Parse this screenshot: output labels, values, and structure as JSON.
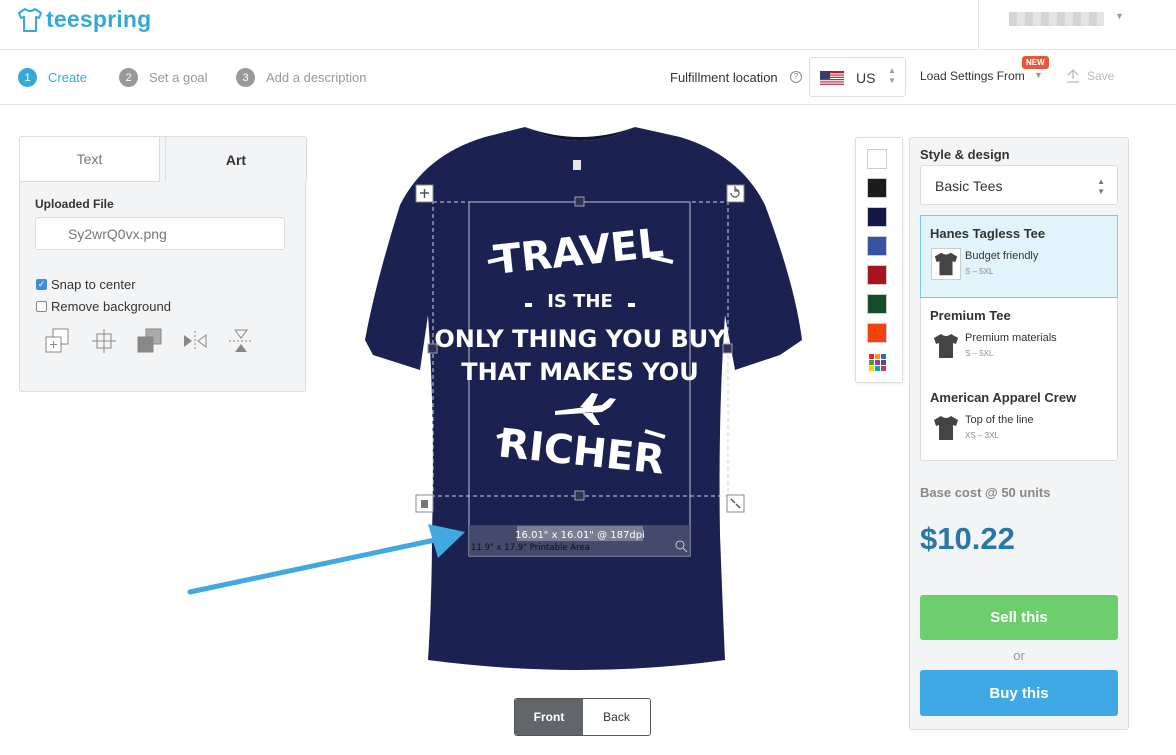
{
  "brand": {
    "name": "teespring",
    "color": "#36a9d8"
  },
  "steps": [
    {
      "num": "1",
      "label": "Create"
    },
    {
      "num": "2",
      "label": "Set a goal"
    },
    {
      "num": "3",
      "label": "Add a description"
    }
  ],
  "fulfillment": {
    "label": "Fulfillment location",
    "country": "US"
  },
  "load_settings": {
    "label": "Load Settings From",
    "badge": "NEW"
  },
  "save_label": "Save",
  "left_panel": {
    "tabs": {
      "text": "Text",
      "art": "Art"
    },
    "uploaded_label": "Uploaded File",
    "file_value": "Sy2wrQ0vx.png",
    "snap_label": "Snap to center",
    "snap_checked": true,
    "remove_bg_label": "Remove background",
    "remove_bg_checked": false,
    "tools": [
      "bring-forward-icon",
      "center-icon",
      "send-backward-icon",
      "flip-horizontal-icon",
      "flip-vertical-icon"
    ]
  },
  "design": {
    "line1": "TRAVEL",
    "line2": "IS THE",
    "line3": "ONLY THING YOU BUY",
    "line4": "THAT MAKES YOU",
    "line5": "RICHER",
    "dpi_label": "16.01\" x 16.01\" @ 187dpi",
    "area_label": "11.9\" x 17.9\" Printable Area",
    "shirt_color": "#1b2150"
  },
  "view_toggle": {
    "front": "Front",
    "back": "Back",
    "active": "front"
  },
  "swatches": [
    "#ffffff",
    "#1c1c1c",
    "#141a45",
    "#3a52a3",
    "#a8141d",
    "#154d2a",
    "#f0440f"
  ],
  "right_panel": {
    "style_label": "Style & design",
    "style_value": "Basic Tees",
    "products": [
      {
        "name": "Hanes Tagless Tee",
        "desc": "Budget friendly",
        "sizes": "S – 5XL",
        "selected": true
      },
      {
        "name": "Premium Tee",
        "desc": "Premium materials",
        "sizes": "S – 5XL",
        "selected": false
      },
      {
        "name": "American Apparel Crew",
        "desc": "Top of the line",
        "sizes": "XS – 3XL",
        "selected": false
      }
    ],
    "base_cost_label": "Base cost @ 50 units",
    "price": "$10.22",
    "sell_label": "Sell this",
    "or_label": "or",
    "buy_label": "Buy this"
  }
}
